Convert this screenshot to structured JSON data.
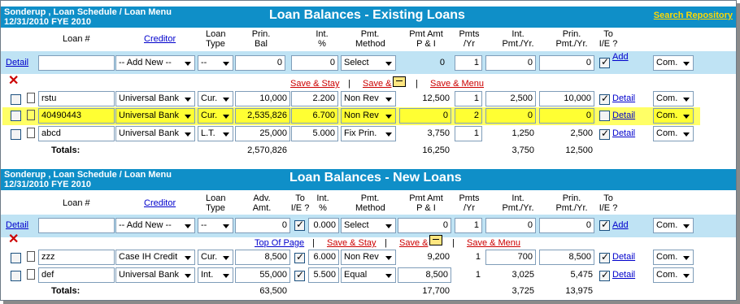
{
  "existing": {
    "crumb1": "Sonderup , Loan Schedule / Loan Menu",
    "crumb2": "12/31/2010 FYE 2010",
    "title": "Loan Balances - Existing Loans",
    "search_link": "Search Repository",
    "cols": {
      "loan": "Loan #",
      "creditor": "Creditor",
      "type1": "Loan",
      "type2": "Type",
      "prin1": "Prin.",
      "prin2": "Bal",
      "int1": "Int.",
      "int2": "%",
      "pmt1": "Pmt.",
      "pmt2": "Method",
      "amt1": "Pmt Amt",
      "amt2": "P & I",
      "pmts1": "Pmts",
      "pmts2": "/Yr",
      "intyr1": "Int.",
      "intyr2": "Pmt./Yr.",
      "prinyr1": "Prin.",
      "prinyr2": "Pmt./Yr.",
      "toie1": "To",
      "toie2": "I/E ?"
    },
    "add_row": {
      "detail": "Detail",
      "loan": "",
      "creditor": "-- Add New --",
      "type": "--",
      "prin": "0",
      "int": "0",
      "method": "Select",
      "amt": "0",
      "pmts": "1",
      "intyr": "0",
      "prinyr": "0",
      "add": "Add",
      "com": "Com."
    },
    "actions": {
      "save_stay": "Save & Stay",
      "save_and": "Save &",
      "save_menu": "Save & Menu",
      "sep": "|"
    },
    "rows": [
      {
        "loan": "rstu",
        "creditor": "Universal Bank",
        "type": "Cur.",
        "prin": "10,000",
        "int": "2.200",
        "method": "Non Rev",
        "amt": "12,500",
        "pmts": "1",
        "intyr": "2,500",
        "prinyr": "10,000",
        "detail": "Detail",
        "com": "Com."
      },
      {
        "loan": "40490443",
        "creditor": "Universal Bank",
        "type": "Cur.",
        "prin": "2,535,826",
        "int": "6.700",
        "method": "Non Rev",
        "amt": "0",
        "pmts": "2",
        "intyr": "0",
        "prinyr": "0",
        "detail": "Detail",
        "com": "Com."
      },
      {
        "loan": "abcd",
        "creditor": "Universal Bank",
        "type": "L.T.",
        "prin": "25,000",
        "int": "5.000",
        "method": "Fix Prin.",
        "amt": "3,750",
        "pmts": "1",
        "intyr": "1,250",
        "prinyr": "2,500",
        "detail": "Detail",
        "com": "Com."
      }
    ],
    "totals": {
      "label": "Totals:",
      "prin": "2,570,826",
      "amt": "16,250",
      "intyr": "3,750",
      "prinyr": "12,500"
    }
  },
  "new": {
    "crumb1": "Sonderup , Loan Schedule / Loan Menu",
    "crumb2": "12/31/2010 FYE 2010",
    "title": "Loan Balances - New Loans",
    "cols": {
      "loan": "Loan #",
      "creditor": "Creditor",
      "type1": "Loan",
      "type2": "Type",
      "adv1": "Adv.",
      "adv2": "Amt.",
      "toie1": "To",
      "toie2": "I/E ?",
      "int1": "Int.",
      "int2": "%",
      "pmt1": "Pmt.",
      "pmt2": "Method",
      "amt1": "Pmt Amt",
      "amt2": "P & I",
      "pmts1": "Pmts",
      "pmts2": "/Yr",
      "intyr1": "Int.",
      "intyr2": "Pmt./Yr.",
      "prinyr1": "Prin.",
      "prinyr2": "Pmt./Yr.",
      "toie3": "To",
      "toie4": "I/E ?"
    },
    "add_row": {
      "detail": "Detail",
      "loan": "",
      "creditor": "-- Add New --",
      "type": "--",
      "adv": "0",
      "int": "0.000",
      "method": "Select",
      "amt": "0",
      "pmts": "1",
      "intyr": "0",
      "prinyr": "0",
      "add": "Add",
      "com": "Com."
    },
    "actions": {
      "top": "Top Of Page",
      "save_stay": "Save & Stay",
      "save_and": "Save &",
      "save_menu": "Save & Menu",
      "sep": "|"
    },
    "rows": [
      {
        "loan": "zzz",
        "creditor": "Case IH Credit",
        "type": "Cur.",
        "adv": "8,500",
        "int": "6.000",
        "method": "Non Rev",
        "amt": "9,200",
        "pmts": "1",
        "intyr": "700",
        "prinyr": "8,500",
        "detail": "Detail",
        "com": "Com."
      },
      {
        "loan": "def",
        "creditor": "Universal Bank",
        "type": "Int.",
        "adv": "55,000",
        "int": "5.500",
        "method": "Equal",
        "amt": "8,500",
        "pmts": "1",
        "intyr": "3,025",
        "prinyr": "5,475",
        "detail": "Detail",
        "com": "Com."
      }
    ],
    "totals": {
      "label": "Totals:",
      "adv": "63,500",
      "amt": "17,700",
      "intyr": "3,725",
      "prinyr": "13,975"
    }
  }
}
